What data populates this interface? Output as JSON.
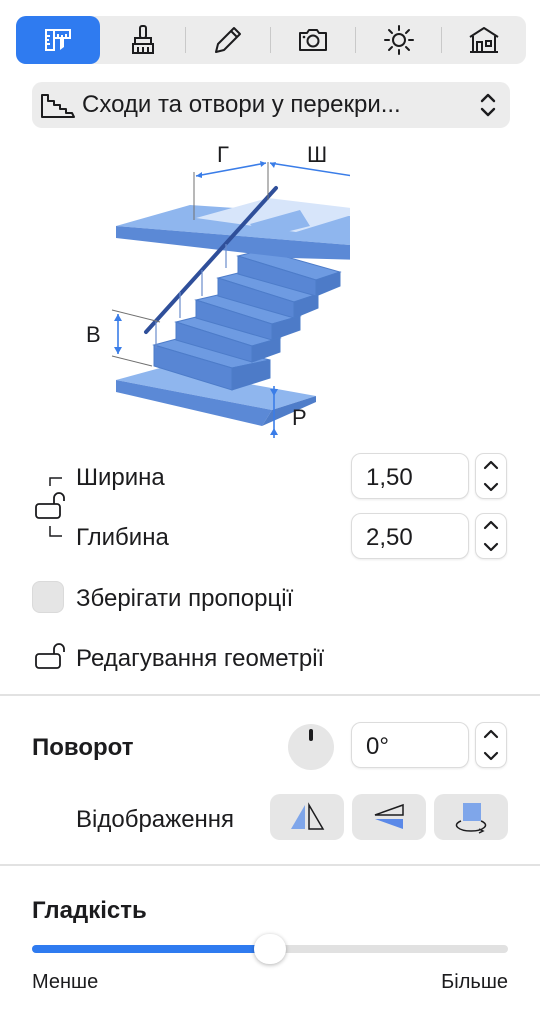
{
  "toolbar": {
    "tabs": [
      {
        "icon": "ruler-caliper-icon",
        "active": true
      },
      {
        "icon": "paint-brush-icon",
        "active": false
      },
      {
        "icon": "pencil-icon",
        "active": false
      },
      {
        "icon": "camera-icon",
        "active": false
      },
      {
        "icon": "sun-icon",
        "active": false
      },
      {
        "icon": "house-icon",
        "active": false
      }
    ],
    "accent": "#2f7bf0"
  },
  "object_selector": {
    "icon": "stairs-icon",
    "value": "Сходи та отвори у перекри..."
  },
  "illustration": {
    "labels": {
      "g": "Г",
      "sh": "Ш",
      "v": "В",
      "r": "Р"
    },
    "stair_color": "#6e9be2"
  },
  "dimensions": {
    "width_label": "Ширина",
    "width_value": "1,50",
    "depth_label": "Глибина",
    "depth_value": "2,50",
    "lock_icon": "lock-open-icon"
  },
  "keep_proportions": {
    "label": "Зберігати пропорції",
    "checked": false
  },
  "edit_geometry": {
    "label": "Редагування геометрії",
    "icon": "lock-open-icon"
  },
  "rotation": {
    "title": "Поворот",
    "value": "0°",
    "mirror_label": "Відображення",
    "mirror_buttons": [
      "flip-horizontal-icon",
      "flip-vertical-icon",
      "rotate-3d-icon"
    ]
  },
  "smoothness": {
    "title": "Гладкість",
    "min_label": "Менше",
    "max_label": "Більше",
    "value": 0.5
  }
}
